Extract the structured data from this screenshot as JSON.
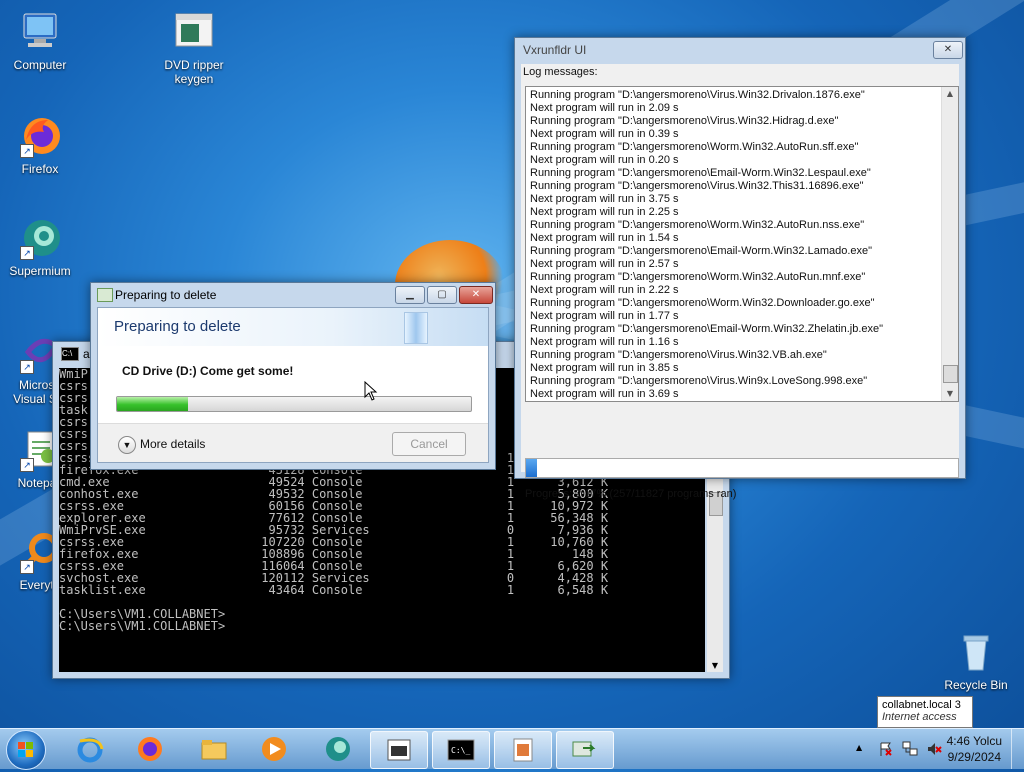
{
  "desktop": {
    "icons": [
      {
        "label": "Computer"
      },
      {
        "label": "DVD ripper\nkeygen"
      },
      {
        "label": "Firefox"
      },
      {
        "label": "Supermium"
      },
      {
        "label": "Microso\nVisual Stu"
      },
      {
        "label": "Notepac"
      },
      {
        "label": "Everyth"
      },
      {
        "label": "Recycle Bin"
      }
    ]
  },
  "cmd": {
    "partial_title": "as",
    "lines": [
      "WmiP",
      "csrs",
      "csrs",
      "task",
      "csrs",
      "csrs",
      "csrs",
      "csrss.exe                    42176 Console                    1        136 K",
      "firefox.exe                  45128 Console                    1        136 K",
      "cmd.exe                      49524 Console                    1      3,612 K",
      "conhost.exe                  49532 Console                    1      5,800 K",
      "csrss.exe                    60156 Console                    1     10,972 K",
      "explorer.exe                 77612 Console                    1     56,348 K",
      "WmiPrvSE.exe                 95732 Services                   0      7,936 K",
      "csrss.exe                   107220 Console                    1     10,760 K",
      "firefox.exe                 108896 Console                    1        148 K",
      "csrss.exe                   116064 Console                    1      6,620 K",
      "svchost.exe                 120112 Services                   0      4,428 K",
      "tasklist.exe                 43464 Console                    1      6,548 K",
      "",
      "C:\\Users\\VM1.COLLABNET>",
      "C:\\Users\\VM1.COLLABNET>"
    ]
  },
  "prep": {
    "title": "Preparing to delete",
    "heading": "Preparing to delete",
    "drive": "CD Drive (D:) Come get some!",
    "progress": 0.2,
    "more_details": "More details",
    "cancel": "Cancel"
  },
  "vx": {
    "title": "Vxrunfldr UI",
    "log_label": "Log messages:",
    "log": [
      "Running program \"D:\\angersmoreno\\Virus.Win32.Drivalon.1876.exe\"",
      "Next program will run in 2.09 s",
      "Running program \"D:\\angersmoreno\\Virus.Win32.Hidrag.d.exe\"",
      "Next program will run in 0.39 s",
      "Running program \"D:\\angersmoreno\\Worm.Win32.AutoRun.sff.exe\"",
      "Next program will run in 0.20 s",
      "Running program \"D:\\angersmoreno\\Email-Worm.Win32.Lespaul.exe\"",
      "Running program \"D:\\angersmoreno\\Virus.Win32.This31.16896.exe\"",
      "Next program will run in 3.75 s",
      "Next program will run in 2.25 s",
      "Running program \"D:\\angersmoreno\\Worm.Win32.AutoRun.nss.exe\"",
      "Next program will run in 1.54 s",
      "Running program \"D:\\angersmoreno\\Email-Worm.Win32.Lamado.exe\"",
      "Next program will run in 2.57 s",
      "Running program \"D:\\angersmoreno\\Worm.Win32.AutoRun.mnf.exe\"",
      "Next program will run in 2.22 s",
      "Running program \"D:\\angersmoreno\\Worm.Win32.Downloader.go.exe\"",
      "Next program will run in 1.77 s",
      "Running program \"D:\\angersmoreno\\Email-Worm.Win32.Zhelatin.jb.exe\"",
      "Next program will run in 1.16 s",
      "Running program \"D:\\angersmoreno\\Virus.Win32.VB.ah.exe\"",
      "Next program will run in 3.85 s",
      "Running program \"D:\\angersmoreno\\Virus.Win9x.LoveSong.998.exe\"",
      "Next program will run in 3.69 s"
    ],
    "progress_fraction": 0.0217,
    "progress_text": "Progress: 2.17% (257/11827 programs ran)"
  },
  "tooltip": {
    "line1": "collabnet.local  3",
    "line2": "Internet access"
  },
  "clock": {
    "time": "4:46 Yolcu",
    "date": "9/29/2024"
  },
  "colors": {
    "accent": "#1d6fd0",
    "progress_green": "#37c22b"
  }
}
